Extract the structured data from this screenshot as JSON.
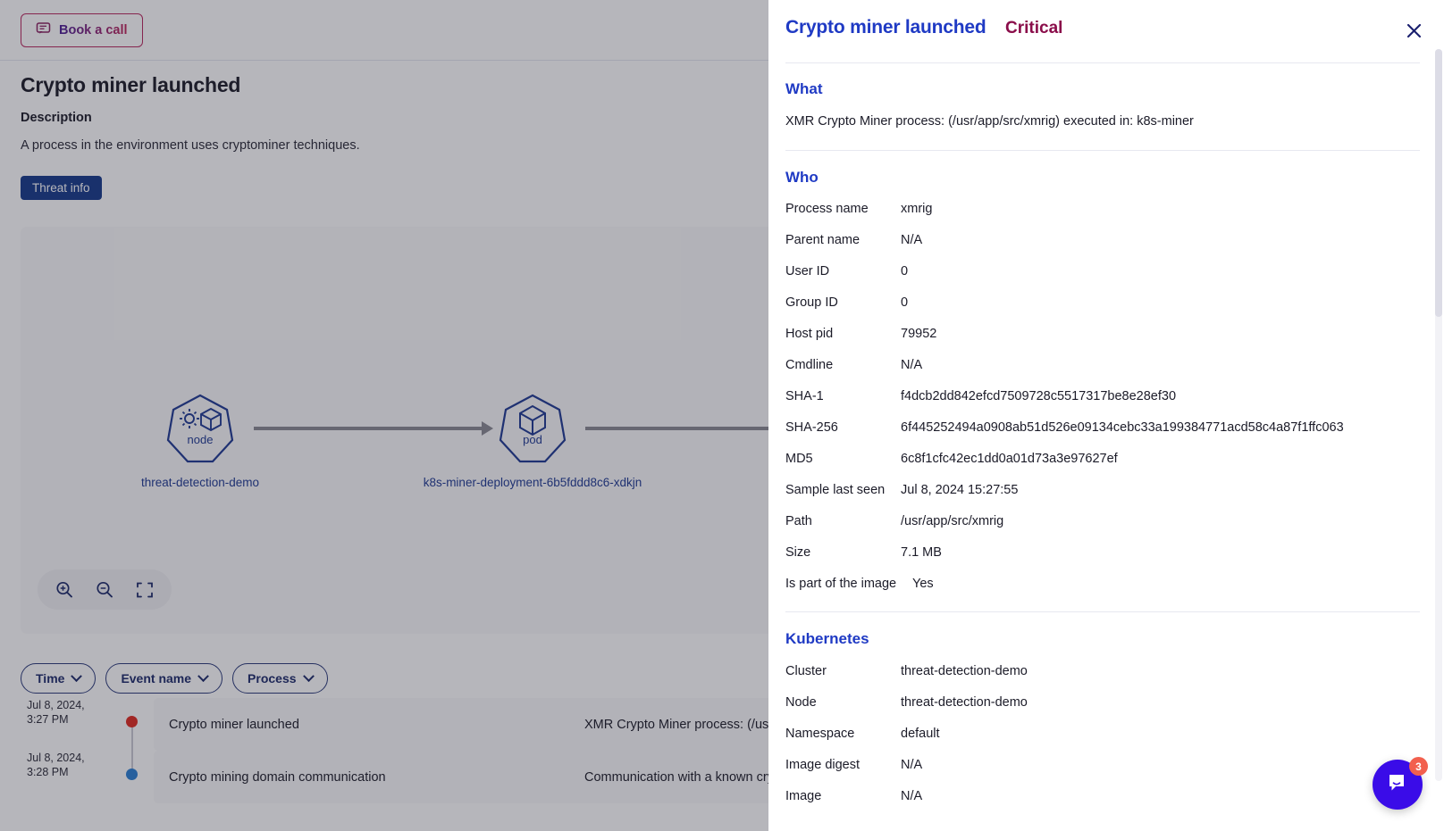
{
  "background": {
    "book_call": {
      "label": "Book a call",
      "icon": "chat-bubble-icon"
    },
    "page_title": "Crypto miner launched",
    "description_heading": "Description",
    "description_text": "A process in the environment uses cryptominer techniques.",
    "threat_info_button": "Threat info",
    "graph": {
      "nodes": [
        {
          "type": "node",
          "type_label": "node",
          "caption": "threat-detection-demo",
          "icon": "gear-cube-icon"
        },
        {
          "type": "pod",
          "type_label": "pod",
          "caption": "k8s-miner-deployment-6b5fddd8c6-xdkjn",
          "icon": "cube-icon"
        }
      ],
      "zoom_controls": [
        {
          "name": "zoom-in",
          "icon": "magnifier-plus-icon"
        },
        {
          "name": "zoom-out",
          "icon": "magnifier-minus-icon"
        },
        {
          "name": "fit-to-screen",
          "icon": "expand-icon"
        }
      ]
    },
    "filters": [
      {
        "label": "Time",
        "icon": "chevron-down-icon"
      },
      {
        "label": "Event name",
        "icon": "chevron-down-icon"
      },
      {
        "label": "Process",
        "icon": "chevron-down-icon"
      }
    ],
    "events": [
      {
        "time": "Jul 8, 2024, 3:27 PM",
        "time_line1": "Jul 8, 2024,",
        "time_line2": "3:27 PM",
        "dot_color": "#e02b20",
        "name": "Crypto miner launched",
        "description": "XMR Crypto Miner process: (/usr"
      },
      {
        "time": "Jul 8, 2024, 3:28 PM",
        "time_line1": "Jul 8, 2024,",
        "time_line2": "3:28 PM",
        "dot_color": "#2b7fd4",
        "name": "Crypto mining domain communication",
        "description": "Communication with a known cry"
      }
    ]
  },
  "panel": {
    "title": "Crypto miner launched",
    "severity": "Critical",
    "severity_color": "#8a0d4a",
    "title_color": "#1f3ac4",
    "close_icon": "close-icon",
    "sections": [
      {
        "heading": "What",
        "body": "XMR Crypto Miner process: (/usr/app/src/xmrig) executed in: k8s-miner"
      },
      {
        "heading": "Who",
        "rows": [
          {
            "key": "Process name",
            "value": "xmrig"
          },
          {
            "key": "Parent name",
            "value": "N/A"
          },
          {
            "key": "User ID",
            "value": "0"
          },
          {
            "key": "Group ID",
            "value": "0"
          },
          {
            "key": "Host pid",
            "value": "79952"
          },
          {
            "key": "Cmdline",
            "value": "N/A"
          },
          {
            "key": "SHA-1",
            "value": "f4dcb2dd842efcd7509728c5517317be8e28ef30"
          },
          {
            "key": "SHA-256",
            "value": "6f445252494a0908ab51d526e09134cebc33a199384771acd58c4a87f1ffc063"
          },
          {
            "key": "MD5",
            "value": "6c8f1cfc42ec1dd0a01d73a3e97627ef"
          },
          {
            "key": "Sample last seen",
            "value": "Jul 8, 2024 15:27:55"
          },
          {
            "key": "Path",
            "value": "/usr/app/src/xmrig"
          },
          {
            "key": "Size",
            "value": "7.1 MB"
          },
          {
            "key": "Is part of the image",
            "value": "Yes"
          }
        ]
      },
      {
        "heading": "Kubernetes",
        "rows": [
          {
            "key": "Cluster",
            "value": "threat-detection-demo"
          },
          {
            "key": "Node",
            "value": "threat-detection-demo"
          },
          {
            "key": "Namespace",
            "value": "default"
          },
          {
            "key": "Image digest",
            "value": "N/A"
          },
          {
            "key": "Image",
            "value": "N/A"
          }
        ]
      }
    ]
  },
  "chat": {
    "icon": "chat-widget-icon",
    "badge_count": "3",
    "badge_color": "#f2604e",
    "button_color": "#3a0ce8"
  }
}
